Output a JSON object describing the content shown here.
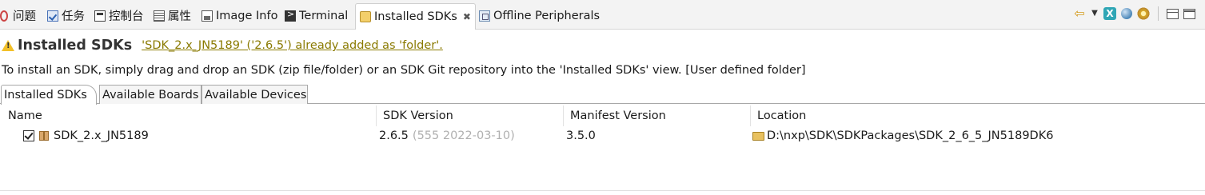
{
  "view_tabs": [
    {
      "label": "",
      "icon": "error-markers-icon"
    },
    {
      "label": "问题",
      "icon": "problems-icon"
    },
    {
      "label": "任务",
      "icon": "tasks-icon"
    },
    {
      "label": "控制台",
      "icon": "console-icon"
    },
    {
      "label": "属性",
      "icon": "properties-icon"
    },
    {
      "label": "Image Info",
      "icon": "image-info-icon"
    },
    {
      "label": "Terminal",
      "icon": "terminal-icon"
    },
    {
      "label": "Installed SDKs",
      "icon": "sdk-icon",
      "active": true,
      "close": "✖"
    },
    {
      "label": "Offline Peripherals",
      "icon": "peripherals-icon"
    }
  ],
  "toolbar": {
    "back_glyph": "⇦",
    "dropdown_glyph": "▼",
    "x_glyph": "X"
  },
  "view": {
    "title": "Installed SDKs",
    "message": "'SDK_2.x_JN5189' ('2.6.5') already added as 'folder'.",
    "hint": "To install an SDK, simply drag and drop an SDK (zip file/folder) or an SDK Git repository into the 'Installed SDKs' view. [User defined folder]"
  },
  "inner_tabs": [
    "Installed SDKs",
    "Available Boards",
    "Available Devices"
  ],
  "table": {
    "columns": [
      "Name",
      "SDK Version",
      "Manifest Version",
      "Location"
    ],
    "rows": [
      {
        "checked": true,
        "name": "SDK_2.x_JN5189",
        "version": "2.6.5",
        "version_detail": "(555 2022-03-10)",
        "manifest": "3.5.0",
        "location": "D:\\nxp\\SDK\\SDKPackages\\SDK_2_6_5_JN5189DK6"
      }
    ]
  }
}
